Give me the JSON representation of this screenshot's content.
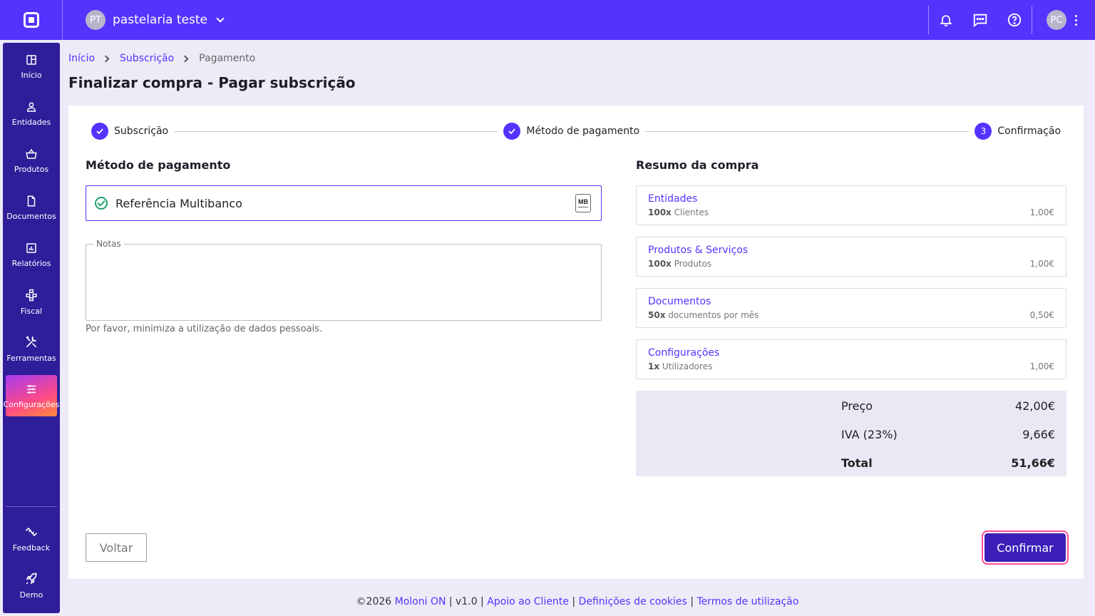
{
  "header": {
    "company_initials": "PT",
    "company_name": "pastelaria teste",
    "user_initials": "PC"
  },
  "sidebar": {
    "items": [
      {
        "label": "Início",
        "icon": "dashboard-icon"
      },
      {
        "label": "Entidades",
        "icon": "user-icon"
      },
      {
        "label": "Produtos",
        "icon": "basket-icon"
      },
      {
        "label": "Documentos",
        "icon": "document-icon"
      },
      {
        "label": "Relatórios",
        "icon": "chart-icon"
      },
      {
        "label": "Fiscal",
        "icon": "network-icon"
      },
      {
        "label": "Ferramentas",
        "icon": "tools-icon"
      },
      {
        "label": "Configurações",
        "icon": "sliders-icon"
      }
    ],
    "bottom": [
      {
        "label": "Feedback",
        "icon": "feedback-icon"
      },
      {
        "label": "Demo",
        "icon": "rocket-icon"
      }
    ]
  },
  "breadcrumb": {
    "home": "Início",
    "subscription": "Subscrição",
    "current": "Pagamento"
  },
  "page": {
    "title": "Finalizar compra - Pagar subscrição"
  },
  "stepper": {
    "step1": "Subscrição",
    "step2": "Método de pagamento",
    "step3_number": "3",
    "step3": "Confirmação"
  },
  "payment": {
    "title": "Método de pagamento",
    "option": "Referência Multibanco",
    "mb_logo": "MB",
    "notes_label": "Notas",
    "notes_value": "",
    "hint": "Por favor, minimiza a utilização de dados pessoais."
  },
  "summary": {
    "title": "Resumo da compra",
    "items": [
      {
        "name": "Entidades",
        "qty": "100x",
        "desc": "Clientes",
        "price": "1,00€"
      },
      {
        "name": "Produtos & Serviços",
        "qty": "100x",
        "desc": "Produtos",
        "price": "1,00€"
      },
      {
        "name": "Documentos",
        "qty": "50x",
        "desc": "documentos por mês",
        "price": "0,50€"
      },
      {
        "name": "Configurações",
        "qty": "1x",
        "desc": "Utilizadores",
        "price": "1,00€"
      }
    ],
    "price_label": "Preço",
    "price_value": "42,00€",
    "vat_label": "IVA (23%)",
    "vat_value": "9,66€",
    "total_label": "Total",
    "total_value": "51,66€"
  },
  "actions": {
    "back": "Voltar",
    "confirm": "Confirmar"
  },
  "footer": {
    "copyright": "©2026",
    "brand": "Moloni ON",
    "version": "| v1.0 |",
    "support": "Apoio ao Cliente",
    "cookies": "Definições de cookies",
    "terms": "Termos de utilização",
    "sep": "|"
  },
  "colors": {
    "brand": "#5533ff",
    "sidebar": "#2f1e9a",
    "confirm": "#3b1fb8",
    "success": "#1fa36a"
  }
}
